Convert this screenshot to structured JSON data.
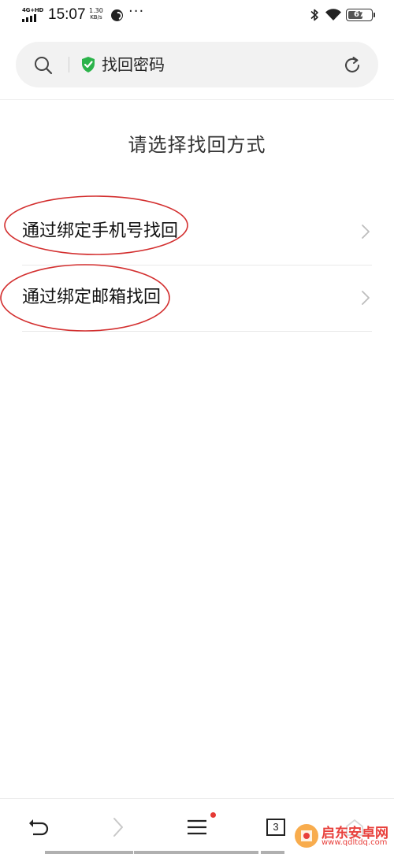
{
  "status_bar": {
    "network": "4G+HD",
    "time": "15:07",
    "speed_value": "1.30",
    "speed_unit": "KB/s",
    "battery_level": "67",
    "battery_fraction": 0.67
  },
  "address_bar": {
    "title": "找回密码"
  },
  "page": {
    "title": "请选择找回方式",
    "options": [
      {
        "label": "通过绑定手机号找回"
      },
      {
        "label": "通过绑定邮箱找回"
      }
    ]
  },
  "bottom_nav": {
    "tab_count": "3"
  },
  "watermark": {
    "name": "启东安卓网",
    "url": "www.qdltdq.com"
  },
  "colors": {
    "shield": "#2bb34a",
    "annotation": "#d32f2f",
    "watermark": "#e8403c",
    "notification_dot": "#e53935"
  }
}
